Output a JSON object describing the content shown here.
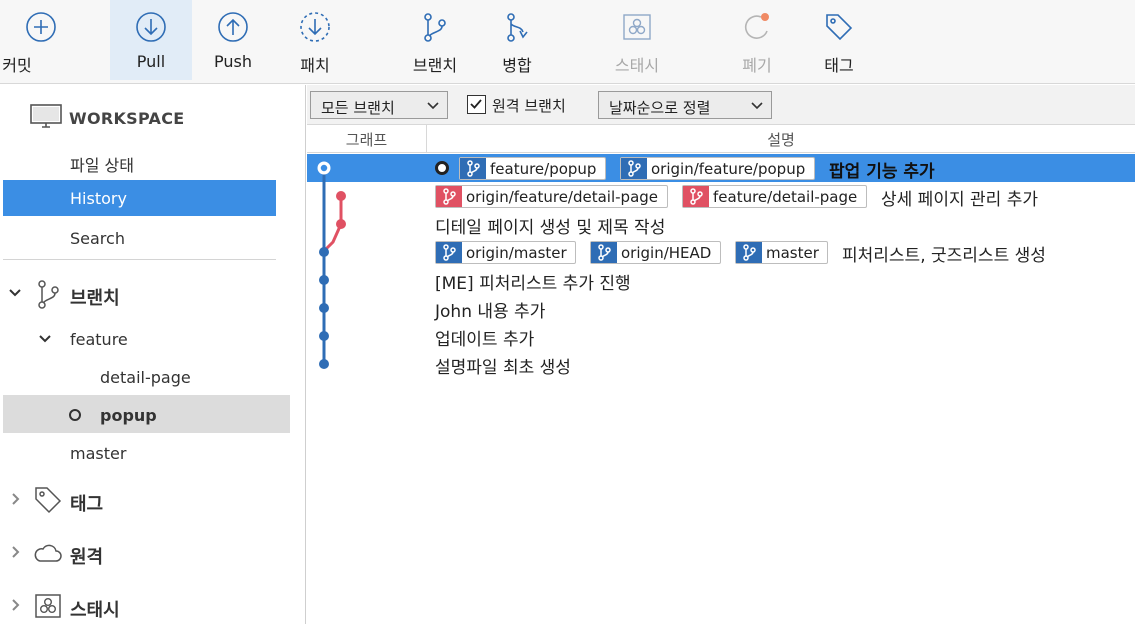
{
  "toolbar": {
    "commit": "커밋",
    "pull": "Pull",
    "push": "Push",
    "fetch": "패치",
    "branch": "브랜치",
    "merge": "병합",
    "stash": "스태시",
    "discard": "폐기",
    "tag": "태그"
  },
  "sidebar": {
    "workspace": "WORKSPACE",
    "file_status": "파일 상태",
    "history": "History",
    "search": "Search",
    "branches": "브랜치",
    "feature_folder": "feature",
    "detail_page": "detail-page",
    "popup": "popup",
    "master": "master",
    "tags": "태그",
    "remotes": "원격",
    "stashes": "스태시"
  },
  "filters": {
    "branch_filter": "모든 브랜치",
    "remote_branches": "원격 브랜치",
    "remote_branches_checked": true,
    "sort_order": "날짜순으로 정렬"
  },
  "columns": {
    "graph": "그래프",
    "description": "설명"
  },
  "commits": [
    {
      "refs": [
        {
          "name": "feature/popup",
          "color": "blue"
        },
        {
          "name": "origin/feature/popup",
          "color": "blue"
        }
      ],
      "message": "팝업 기능 추가",
      "head": true
    },
    {
      "refs": [
        {
          "name": "origin/feature/detail-page",
          "color": "red"
        },
        {
          "name": "feature/detail-page",
          "color": "red"
        }
      ],
      "message": "상세 페이지 관리 추가"
    },
    {
      "refs": [],
      "message": "디테일 페이지 생성 및 제목 작성"
    },
    {
      "refs": [
        {
          "name": "origin/master",
          "color": "blue"
        },
        {
          "name": "origin/HEAD",
          "color": "blue"
        },
        {
          "name": "master",
          "color": "blue"
        }
      ],
      "message": "피처리스트, 굿즈리스트 생성"
    },
    {
      "refs": [],
      "message": "[ME] 피처리스트 추가 진행"
    },
    {
      "refs": [],
      "message": "John 내용 추가"
    },
    {
      "refs": [],
      "message": "업데이트 추가"
    },
    {
      "refs": [],
      "message": "설명파일 최초 생성"
    }
  ],
  "colors": {
    "accent": "#3b8ee4",
    "branch_blue": "#2f6db5",
    "branch_red": "#e05163",
    "selected_item": "#dcdcdc"
  }
}
